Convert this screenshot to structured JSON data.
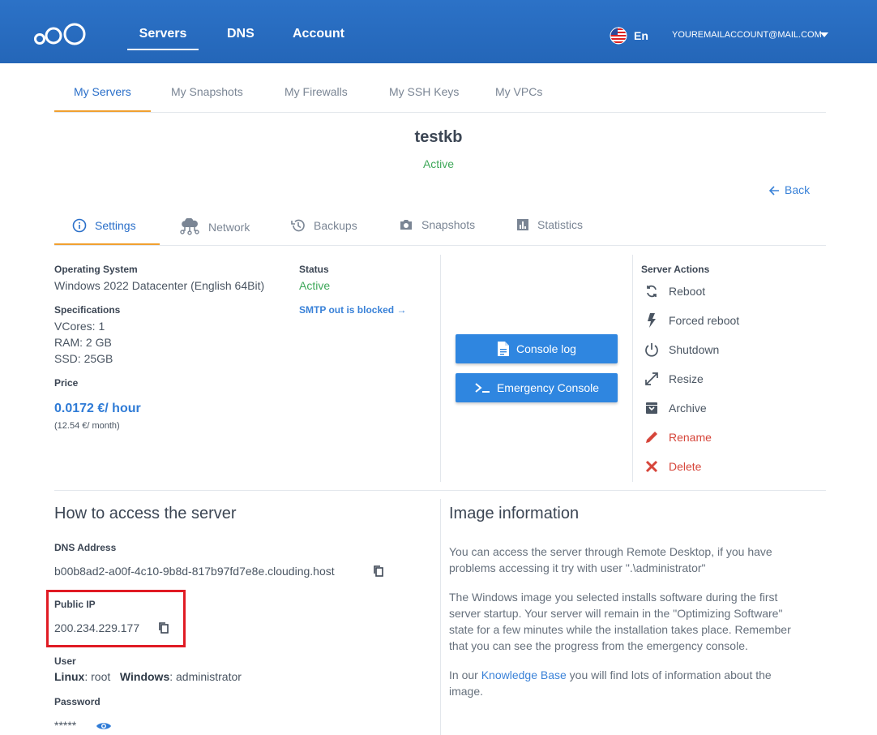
{
  "topnav": {
    "servers": "Servers",
    "dns": "DNS",
    "account": "Account",
    "lang": "En",
    "email": "YOUREMAILACCOUNT@MAIL.COM"
  },
  "subtabs": [
    "My Servers",
    "My Snapshots",
    "My Firewalls",
    "My SSH Keys",
    "My VPCs"
  ],
  "server": {
    "name": "testkb",
    "state": "Active",
    "back": "Back"
  },
  "detail_tabs": [
    "Settings",
    "Network",
    "Backups",
    "Snapshots",
    "Statistics"
  ],
  "settings": {
    "os_label": "Operating System",
    "os_value": "Windows 2022 Datacenter (English 64Bit)",
    "status_label": "Status",
    "status_value": "Active",
    "smtp_link": "SMTP out is blocked →",
    "spec_label": "Specifications",
    "vcores": "VCores: 1",
    "ram": "RAM: 2 GB",
    "ssd": "SSD: 25GB",
    "price_label": "Price",
    "price_hour": "0.0172 €/ hour",
    "price_month": "(12.54 €/ month)"
  },
  "buttons": {
    "console_log": "Console log",
    "emergency_console": "Emergency Console"
  },
  "actions": {
    "title": "Server Actions",
    "items": [
      "Reboot",
      "Forced reboot",
      "Shutdown",
      "Resize",
      "Archive",
      "Rename",
      "Delete"
    ]
  },
  "access": {
    "title": "How to access the server",
    "dns_label": "DNS Address",
    "dns_value": "b00b8ad2-a00f-4c10-9b8d-817b97fd7e8e.clouding.host",
    "ip_label": "Public IP",
    "ip_value": "200.234.229.177",
    "user_label": "User",
    "linux_label": "Linux",
    "linux_value": ": root",
    "windows_label": "Windows",
    "windows_value": ": administrator",
    "password_label": "Password",
    "password_value": "*****"
  },
  "image_info": {
    "title": "Image information",
    "p1": "You can access the server through Remote Desktop, if you have problems accessing it try with user \".\\administrator\"",
    "p2": "The Windows image you selected installs software during the first server startup. Your server will remain in the \"Optimizing Software\" state for a few minutes while the installation takes place. Remember that you can see the progress from the emergency console.",
    "p3_before": "In our ",
    "p3_link": "Knowledge Base",
    "p3_after": " you will find lots of information about the image."
  }
}
